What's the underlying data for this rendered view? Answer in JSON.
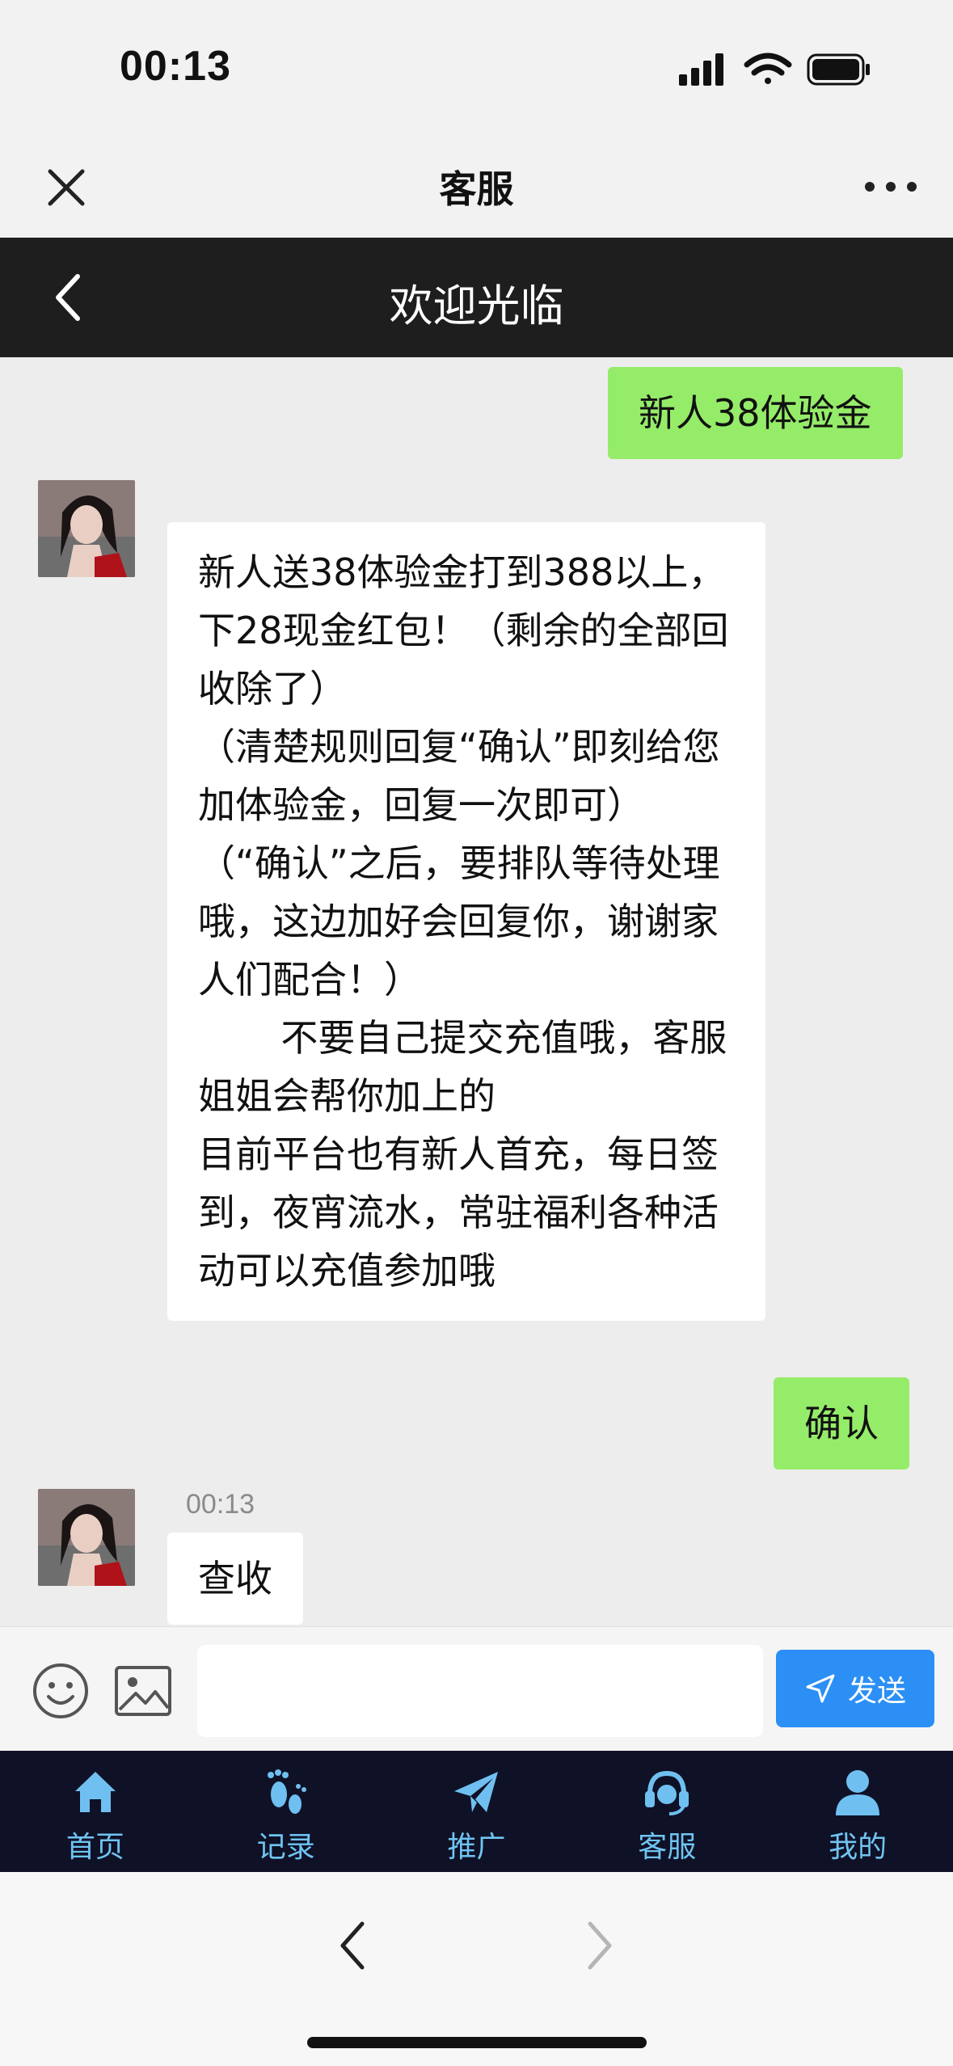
{
  "status_bar": {
    "time": "00:13"
  },
  "title_bar": {
    "title": "客服"
  },
  "header": {
    "title": "欢迎光临"
  },
  "messages": {
    "m1": {
      "side": "sent",
      "text": "新人38体验金"
    },
    "m2": {
      "side": "received",
      "text": "新人送38体验金打到388以上，下28现金红包！（剩余的全部回收除了）\n（清楚规则回复“确认”即刻给您加体验金，回复一次即可）\n（“确认”之后，要排队等待处理哦，这边加好会回复你，谢谢家人们配合！）\n       不要自己提交充值哦，客服姐姐会帮你加上的\n目前平台也有新人首充，每日签到，夜宵流水，常驻福利各种活动可以充值参加哦"
    },
    "m3": {
      "side": "sent",
      "text": "确认"
    },
    "m4": {
      "side": "received",
      "time": "00:13",
      "text": "查收"
    }
  },
  "input_bar": {
    "placeholder": "",
    "value": "",
    "send_label": "发送"
  },
  "bottom_nav": {
    "items": [
      {
        "label": "首页",
        "icon": "home-icon"
      },
      {
        "label": "记录",
        "icon": "footprints-icon"
      },
      {
        "label": "推广",
        "icon": "paper-plane-icon"
      },
      {
        "label": "客服",
        "icon": "headset-icon"
      },
      {
        "label": "我的",
        "icon": "user-icon"
      }
    ]
  },
  "colors": {
    "sent_bubble": "#95ec69",
    "header_bg": "#1e1e1e",
    "send_button": "#2b8ff5",
    "nav_bg": "#0f1126",
    "nav_accent": "#70c4f2"
  }
}
